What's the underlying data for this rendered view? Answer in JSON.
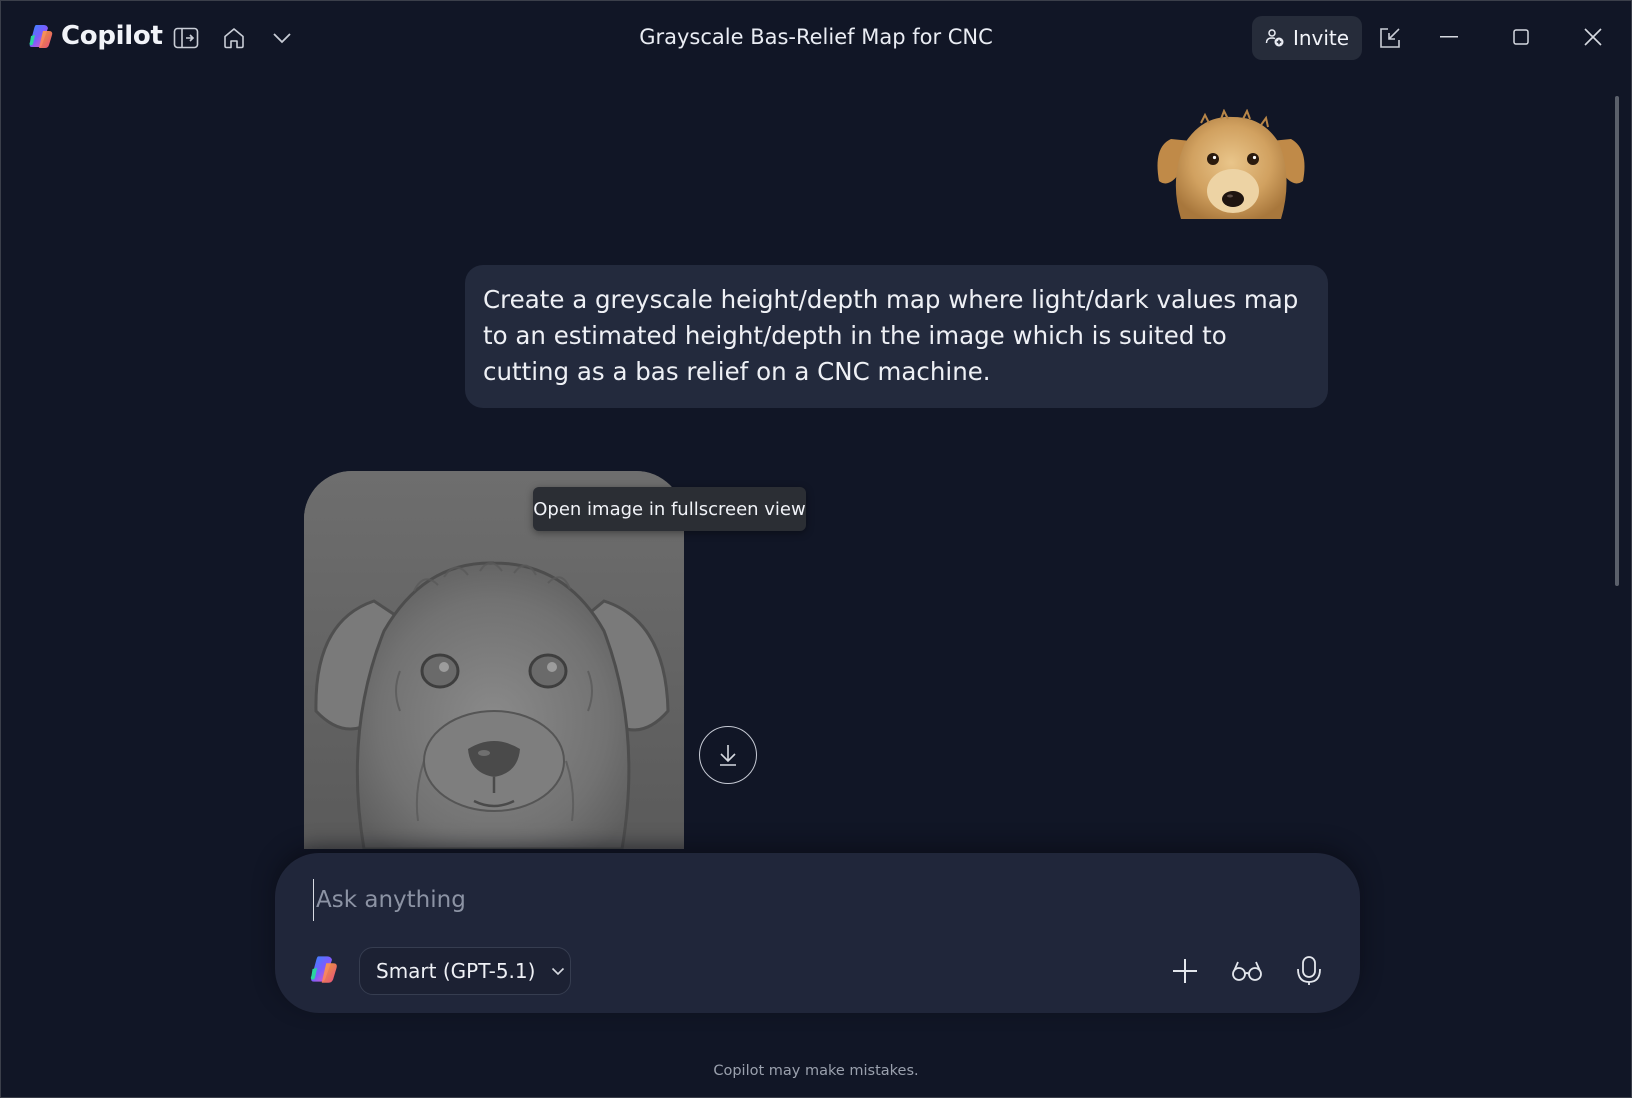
{
  "app": {
    "name": "Copilot",
    "window_title": "Grayscale Bas-Relief Map for CNC",
    "invite_label": "Invite"
  },
  "conversation": {
    "user_message": "Create a greyscale height/depth map where light/dark values map to an estimated height/depth in the image which is suited to cutting as a bas relief on a CNC machine.",
    "tooltip": "Open image in fullscreen view"
  },
  "composer": {
    "placeholder": "Ask anything",
    "model_label": "Smart (GPT-5.1)"
  },
  "footer": {
    "disclaimer": "Copilot may make mistakes."
  },
  "icons": {
    "sidebar": "sidebar-toggle-icon",
    "home": "home-icon",
    "dropdown": "chevron-down-icon",
    "popout": "popout-icon",
    "minimize": "minimize-icon",
    "maximize": "maximize-icon",
    "close": "close-icon",
    "download": "download-icon",
    "add": "plus-icon",
    "vision": "glasses-icon",
    "mic": "microphone-icon"
  },
  "colors": {
    "background": "#111626",
    "bubble": "#232a3d",
    "composer": "#20263a",
    "invite_bg": "#262c3a"
  }
}
